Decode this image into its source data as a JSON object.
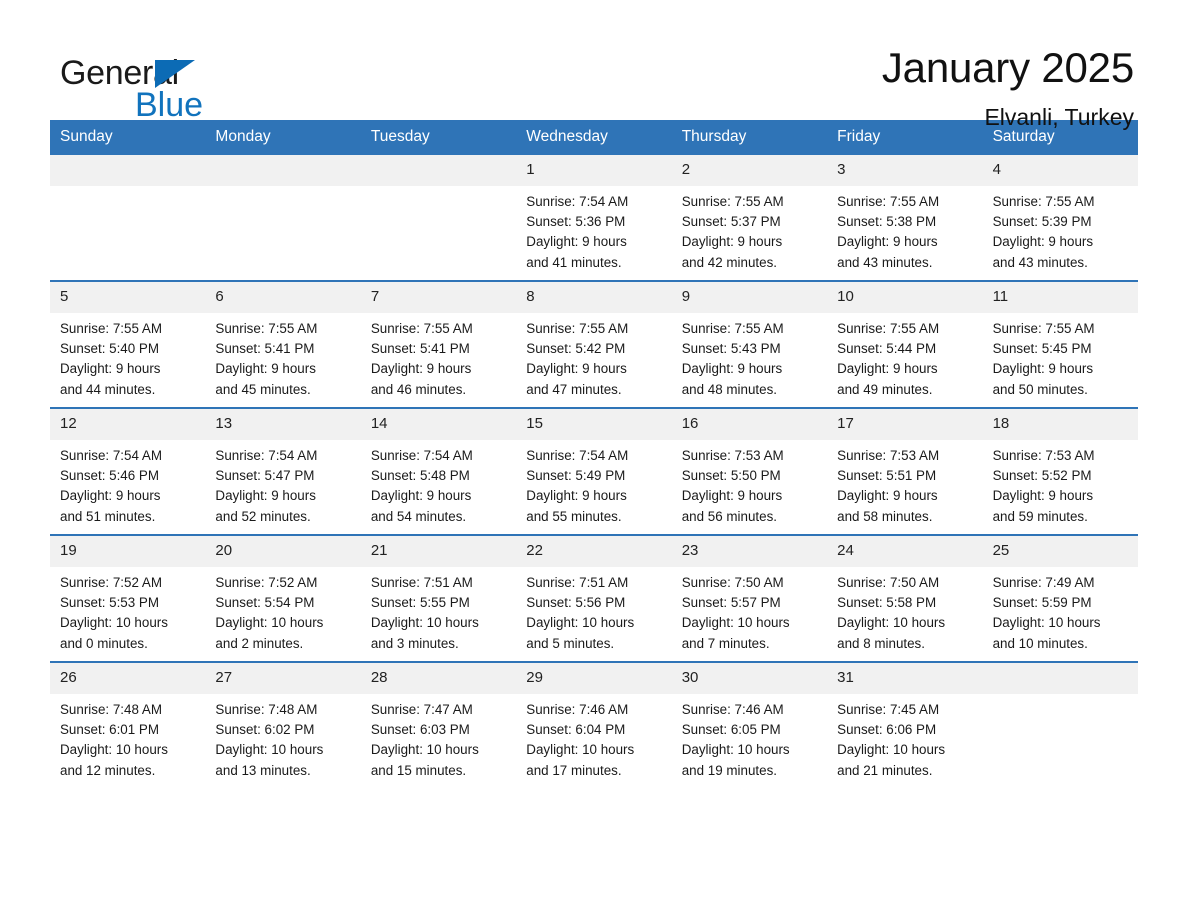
{
  "brand": {
    "word_one": "General",
    "word_two": "Blue",
    "accent_color": "#1173bd",
    "triangle_color": "#0c6bb5"
  },
  "header": {
    "title": "January 2025",
    "location": "Elvanli, Turkey"
  },
  "calendar": {
    "header_color": "#2f74b7",
    "daynum_bg": "#f1f1f1",
    "weekdays": [
      "Sunday",
      "Monday",
      "Tuesday",
      "Wednesday",
      "Thursday",
      "Friday",
      "Saturday"
    ],
    "weeks": [
      [
        {
          "day": "",
          "lines": []
        },
        {
          "day": "",
          "lines": []
        },
        {
          "day": "",
          "lines": []
        },
        {
          "day": "1",
          "lines": [
            "Sunrise: 7:54 AM",
            "Sunset: 5:36 PM",
            "Daylight: 9 hours",
            "and 41 minutes."
          ]
        },
        {
          "day": "2",
          "lines": [
            "Sunrise: 7:55 AM",
            "Sunset: 5:37 PM",
            "Daylight: 9 hours",
            "and 42 minutes."
          ]
        },
        {
          "day": "3",
          "lines": [
            "Sunrise: 7:55 AM",
            "Sunset: 5:38 PM",
            "Daylight: 9 hours",
            "and 43 minutes."
          ]
        },
        {
          "day": "4",
          "lines": [
            "Sunrise: 7:55 AM",
            "Sunset: 5:39 PM",
            "Daylight: 9 hours",
            "and 43 minutes."
          ]
        }
      ],
      [
        {
          "day": "5",
          "lines": [
            "Sunrise: 7:55 AM",
            "Sunset: 5:40 PM",
            "Daylight: 9 hours",
            "and 44 minutes."
          ]
        },
        {
          "day": "6",
          "lines": [
            "Sunrise: 7:55 AM",
            "Sunset: 5:41 PM",
            "Daylight: 9 hours",
            "and 45 minutes."
          ]
        },
        {
          "day": "7",
          "lines": [
            "Sunrise: 7:55 AM",
            "Sunset: 5:41 PM",
            "Daylight: 9 hours",
            "and 46 minutes."
          ]
        },
        {
          "day": "8",
          "lines": [
            "Sunrise: 7:55 AM",
            "Sunset: 5:42 PM",
            "Daylight: 9 hours",
            "and 47 minutes."
          ]
        },
        {
          "day": "9",
          "lines": [
            "Sunrise: 7:55 AM",
            "Sunset: 5:43 PM",
            "Daylight: 9 hours",
            "and 48 minutes."
          ]
        },
        {
          "day": "10",
          "lines": [
            "Sunrise: 7:55 AM",
            "Sunset: 5:44 PM",
            "Daylight: 9 hours",
            "and 49 minutes."
          ]
        },
        {
          "day": "11",
          "lines": [
            "Sunrise: 7:55 AM",
            "Sunset: 5:45 PM",
            "Daylight: 9 hours",
            "and 50 minutes."
          ]
        }
      ],
      [
        {
          "day": "12",
          "lines": [
            "Sunrise: 7:54 AM",
            "Sunset: 5:46 PM",
            "Daylight: 9 hours",
            "and 51 minutes."
          ]
        },
        {
          "day": "13",
          "lines": [
            "Sunrise: 7:54 AM",
            "Sunset: 5:47 PM",
            "Daylight: 9 hours",
            "and 52 minutes."
          ]
        },
        {
          "day": "14",
          "lines": [
            "Sunrise: 7:54 AM",
            "Sunset: 5:48 PM",
            "Daylight: 9 hours",
            "and 54 minutes."
          ]
        },
        {
          "day": "15",
          "lines": [
            "Sunrise: 7:54 AM",
            "Sunset: 5:49 PM",
            "Daylight: 9 hours",
            "and 55 minutes."
          ]
        },
        {
          "day": "16",
          "lines": [
            "Sunrise: 7:53 AM",
            "Sunset: 5:50 PM",
            "Daylight: 9 hours",
            "and 56 minutes."
          ]
        },
        {
          "day": "17",
          "lines": [
            "Sunrise: 7:53 AM",
            "Sunset: 5:51 PM",
            "Daylight: 9 hours",
            "and 58 minutes."
          ]
        },
        {
          "day": "18",
          "lines": [
            "Sunrise: 7:53 AM",
            "Sunset: 5:52 PM",
            "Daylight: 9 hours",
            "and 59 minutes."
          ]
        }
      ],
      [
        {
          "day": "19",
          "lines": [
            "Sunrise: 7:52 AM",
            "Sunset: 5:53 PM",
            "Daylight: 10 hours",
            "and 0 minutes."
          ]
        },
        {
          "day": "20",
          "lines": [
            "Sunrise: 7:52 AM",
            "Sunset: 5:54 PM",
            "Daylight: 10 hours",
            "and 2 minutes."
          ]
        },
        {
          "day": "21",
          "lines": [
            "Sunrise: 7:51 AM",
            "Sunset: 5:55 PM",
            "Daylight: 10 hours",
            "and 3 minutes."
          ]
        },
        {
          "day": "22",
          "lines": [
            "Sunrise: 7:51 AM",
            "Sunset: 5:56 PM",
            "Daylight: 10 hours",
            "and 5 minutes."
          ]
        },
        {
          "day": "23",
          "lines": [
            "Sunrise: 7:50 AM",
            "Sunset: 5:57 PM",
            "Daylight: 10 hours",
            "and 7 minutes."
          ]
        },
        {
          "day": "24",
          "lines": [
            "Sunrise: 7:50 AM",
            "Sunset: 5:58 PM",
            "Daylight: 10 hours",
            "and 8 minutes."
          ]
        },
        {
          "day": "25",
          "lines": [
            "Sunrise: 7:49 AM",
            "Sunset: 5:59 PM",
            "Daylight: 10 hours",
            "and 10 minutes."
          ]
        }
      ],
      [
        {
          "day": "26",
          "lines": [
            "Sunrise: 7:48 AM",
            "Sunset: 6:01 PM",
            "Daylight: 10 hours",
            "and 12 minutes."
          ]
        },
        {
          "day": "27",
          "lines": [
            "Sunrise: 7:48 AM",
            "Sunset: 6:02 PM",
            "Daylight: 10 hours",
            "and 13 minutes."
          ]
        },
        {
          "day": "28",
          "lines": [
            "Sunrise: 7:47 AM",
            "Sunset: 6:03 PM",
            "Daylight: 10 hours",
            "and 15 minutes."
          ]
        },
        {
          "day": "29",
          "lines": [
            "Sunrise: 7:46 AM",
            "Sunset: 6:04 PM",
            "Daylight: 10 hours",
            "and 17 minutes."
          ]
        },
        {
          "day": "30",
          "lines": [
            "Sunrise: 7:46 AM",
            "Sunset: 6:05 PM",
            "Daylight: 10 hours",
            "and 19 minutes."
          ]
        },
        {
          "day": "31",
          "lines": [
            "Sunrise: 7:45 AM",
            "Sunset: 6:06 PM",
            "Daylight: 10 hours",
            "and 21 minutes."
          ]
        },
        {
          "day": "",
          "lines": []
        }
      ]
    ]
  }
}
